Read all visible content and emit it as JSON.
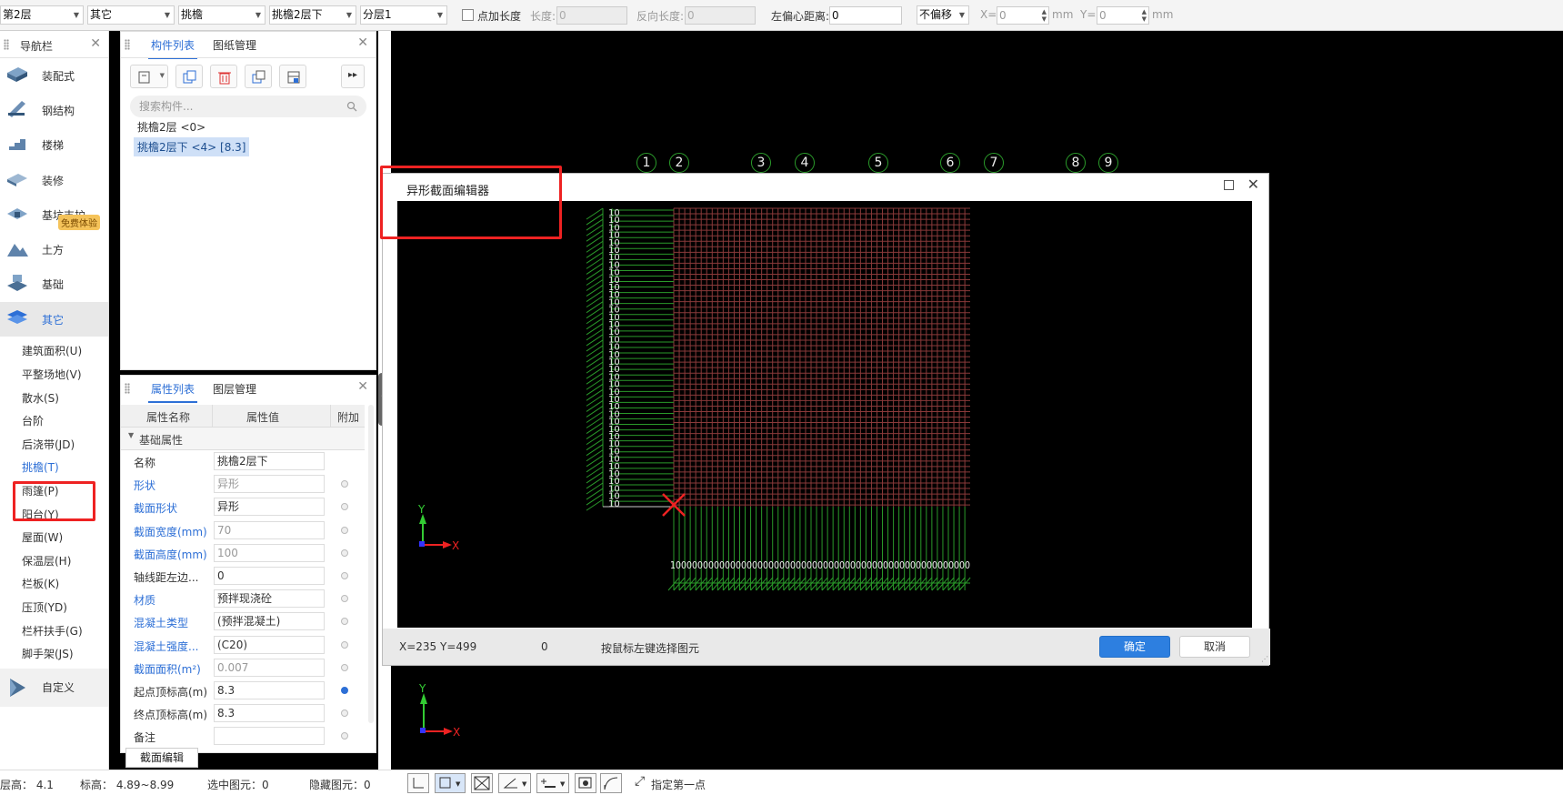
{
  "toolbar": {
    "floor": "第2层",
    "category": "其它",
    "type": "挑檐",
    "element": "挑檐2层下",
    "sublayer": "分层1",
    "add_length_label": "点加长度",
    "length_label": "长度:",
    "length_value": "0",
    "reverse_length_label": "反向长度:",
    "reverse_length_value": "0",
    "left_offset_label": "左偏心距离:",
    "left_offset_value": "0",
    "offset_mode": "不偏移",
    "x_label": "X=",
    "x_value": "0",
    "y_label": "Y=",
    "y_value": "0",
    "unit": "mm"
  },
  "nav": {
    "title": "导航栏",
    "items": [
      {
        "label": "装配式",
        "icon": "prefab-icon"
      },
      {
        "label": "钢结构",
        "icon": "steel-structure-icon"
      },
      {
        "label": "楼梯",
        "icon": "stairs-icon"
      },
      {
        "label": "装修",
        "icon": "decoration-icon"
      },
      {
        "label": "基坑支护",
        "icon": "foundation-pit-icon"
      },
      {
        "label": "土方",
        "icon": "earthwork-icon"
      },
      {
        "label": "基础",
        "icon": "foundation-icon"
      },
      {
        "label": "其它",
        "icon": "other-icon"
      }
    ],
    "badge": "免费体验",
    "subitems": [
      "建筑面积(U)",
      "平整场地(V)",
      "散水(S)",
      "台阶",
      "后浇带(JD)",
      "挑檐(T)",
      "雨篷(P)",
      "阳台(Y)",
      "屋面(W)",
      "保温层(H)",
      "栏板(K)",
      "压顶(YD)",
      "栏杆扶手(G)",
      "脚手架(JS)"
    ],
    "custom": "自定义"
  },
  "complist": {
    "tabs": [
      "构件列表",
      "图纸管理"
    ],
    "search_placeholder": "搜索构件...",
    "items": [
      "挑檐2层 <0>",
      "挑檐2层下 <4> [8.3]"
    ]
  },
  "props": {
    "tabs": [
      "属性列表",
      "图层管理"
    ],
    "headers": [
      "属性名称",
      "属性值",
      "附加"
    ],
    "group": "基础属性",
    "rows": [
      {
        "name": "名称",
        "value": "挑檐2层下"
      },
      {
        "name": "形状",
        "value": "异形"
      },
      {
        "name": "截面形状",
        "value": "异形"
      },
      {
        "name": "截面宽度(mm)",
        "value": "70"
      },
      {
        "name": "截面高度(mm)",
        "value": "100"
      },
      {
        "name": "轴线距左边...",
        "value": "0"
      },
      {
        "name": "材质",
        "value": "预拌现浇砼"
      },
      {
        "name": "混凝土类型",
        "value": "(预拌混凝土)"
      },
      {
        "name": "混凝土强度...",
        "value": "(C20)"
      },
      {
        "name": "截面面积(m²)",
        "value": "0.007"
      },
      {
        "name": "起点顶标高(m)",
        "value": "8.3"
      },
      {
        "name": "终点顶标高(m)",
        "value": "8.3"
      },
      {
        "name": "备注",
        "value": ""
      }
    ],
    "section_edit": "截面编辑"
  },
  "status": {
    "floor_height": "层高： 4.1",
    "elevation": "标高： 4.89~8.99",
    "selected": "选中图元：0",
    "hidden": "隐藏图元：0",
    "hint": "指定第一点"
  },
  "axes": [
    "1",
    "2",
    "3",
    "4",
    "5",
    "6",
    "7",
    "8",
    "9"
  ],
  "dialog": {
    "title": "异形截面编辑器",
    "coords": "X=235 Y=499",
    "count": "0",
    "hint": "按鼠标左键选择图元",
    "ok": "确定",
    "cancel": "取消",
    "left_tick": "10",
    "bottom_ticks": "1000000000000000000000000000000000000000000000000000000"
  },
  "colors": {
    "accent": "#2d6fd6",
    "highlight": "#e22222",
    "grid": "#8a3a3a",
    "guide": "#2a9a2a"
  }
}
